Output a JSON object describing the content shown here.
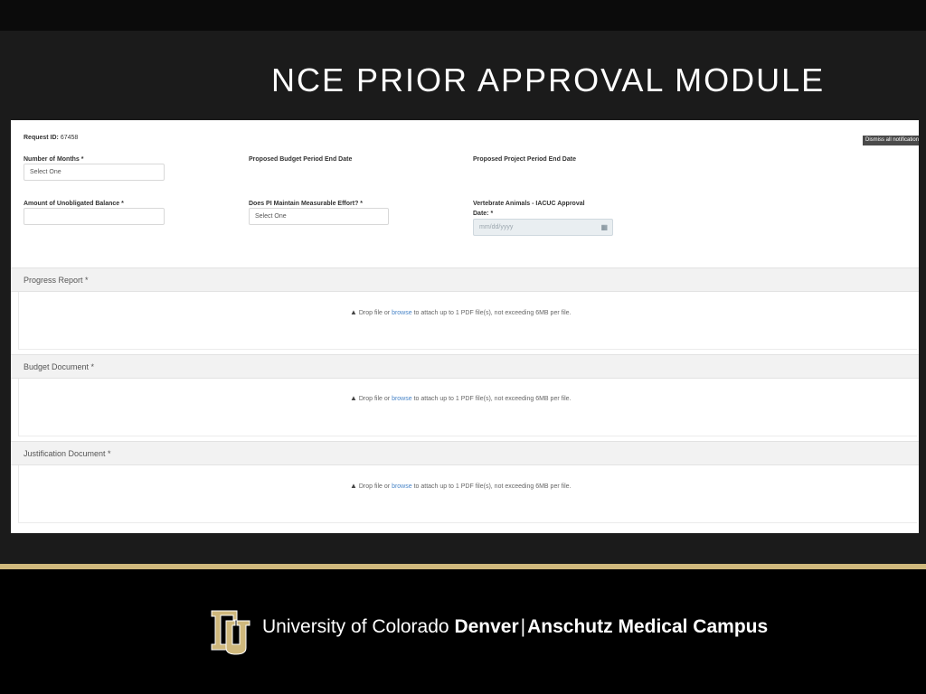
{
  "slide": {
    "title": "NCE PRIOR APPROVAL MODULE"
  },
  "form": {
    "request_id_label": "Request ID:",
    "request_id_value": "67458",
    "notification_button": "Dismiss all notifications",
    "fields": {
      "number_of_months": {
        "label": "Number of Months *",
        "value": "Select One"
      },
      "proposed_budget_end": {
        "label": "Proposed Budget Period End Date"
      },
      "proposed_project_end": {
        "label": "Proposed Project Period End Date"
      },
      "unobligated_balance": {
        "label": "Amount of Unobligated Balance *",
        "value": ""
      },
      "pi_effort": {
        "label": "Does PI Maintain Measurable Effort? *",
        "value": "Select One"
      },
      "iacuc": {
        "label_line1": "Vertebrate Animals - IACUC Approval",
        "label_line2": "Date: *",
        "placeholder": "mm/dd/yyyy"
      }
    },
    "sections": [
      {
        "title": "Progress Report *"
      },
      {
        "title": "Budget Document *"
      },
      {
        "title": "Justification Document *"
      }
    ],
    "dropzone": {
      "pre": "Drop file or ",
      "link": "browse",
      "post": " to attach up to 1 PDF file(s), not exceeding 6MB per file."
    }
  },
  "footer": {
    "university": "University of Colorado",
    "campus_bold": "Denver",
    "separator": "|",
    "campus_name": "Anschutz Medical Campus"
  },
  "colors": {
    "gold": "#cfb87c",
    "background": "#1b1b1b",
    "link": "#4a86c8"
  }
}
